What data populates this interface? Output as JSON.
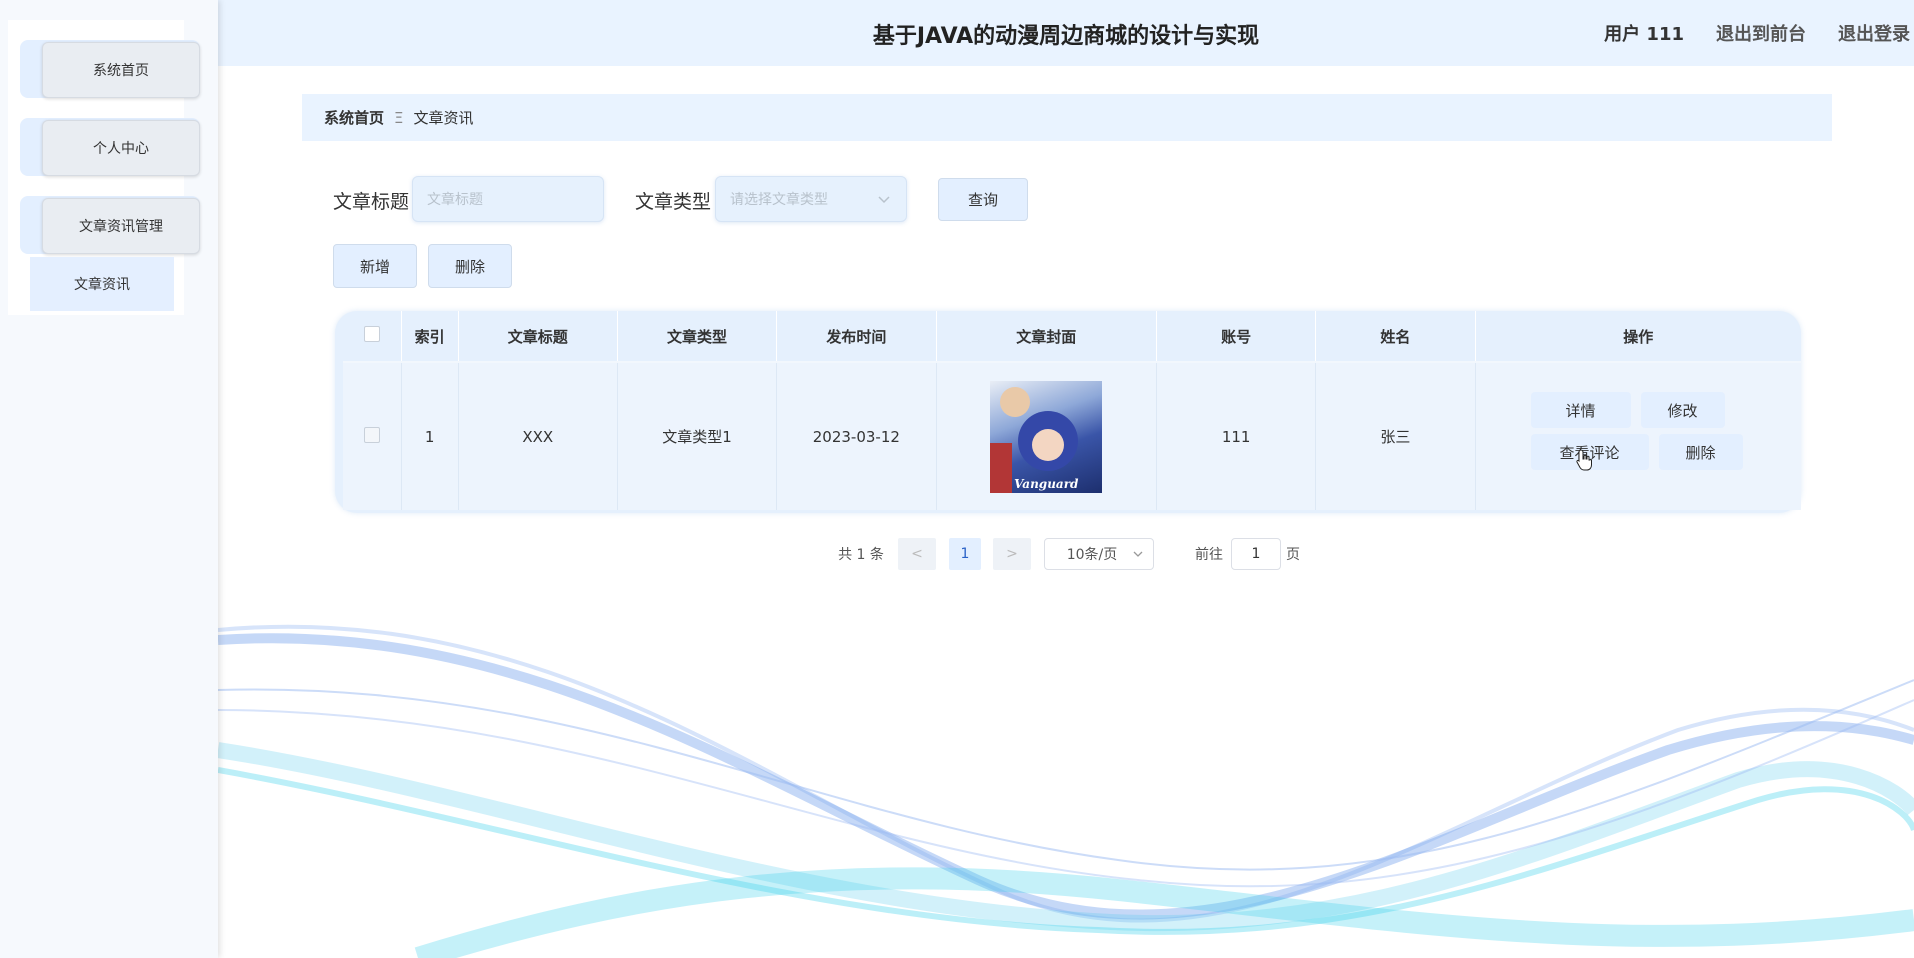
{
  "header": {
    "title": "基于JAVA的动漫周边商城的设计与实现",
    "user": "用户 111",
    "to_front": "退出到前台",
    "logout": "退出登录"
  },
  "sidebar": {
    "items": [
      {
        "label": "系统首页"
      },
      {
        "label": "个人中心"
      },
      {
        "label": "文章资讯管理"
      }
    ],
    "subitems": [
      {
        "label": "文章资讯"
      }
    ]
  },
  "breadcrumb": {
    "home": "系统首页",
    "separator": "Ξ",
    "current": "文章资讯"
  },
  "search": {
    "title_label": "文章标题",
    "title_placeholder": "文章标题",
    "type_label": "文章类型",
    "type_placeholder": "请选择文章类型",
    "query_button": "查询"
  },
  "toolbar": {
    "add": "新增",
    "delete": "删除"
  },
  "table": {
    "columns": [
      "索引",
      "文章标题",
      "文章类型",
      "发布时间",
      "文章封面",
      "账号",
      "姓名",
      "操作"
    ],
    "rows": [
      {
        "index": "1",
        "title": "XXX",
        "type": "文章类型1",
        "publish_time": "2023-03-12",
        "cover_text": "Vanguard",
        "account": "111",
        "name": "张三"
      }
    ],
    "actions": {
      "detail": "详情",
      "edit": "修改",
      "comments": "查看评论",
      "delete": "删除"
    }
  },
  "pagination": {
    "total": "共 1 条",
    "prev": "<",
    "current_page": "1",
    "next": ">",
    "page_size": "10条/页",
    "goto_label": "前往",
    "goto_value": "1",
    "page_unit": "页"
  },
  "colors": {
    "accent_light": "#e3efff",
    "header_bg": "#e9f3ff",
    "wave_blue": "#5a8ee8",
    "wave_cyan": "#3fd2ec"
  }
}
